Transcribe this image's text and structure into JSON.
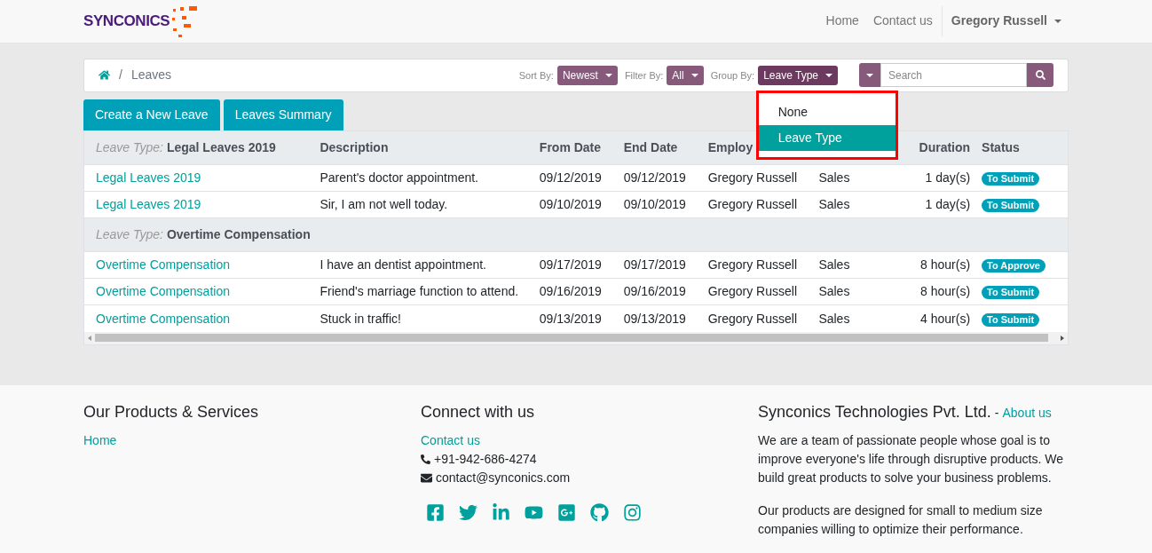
{
  "header": {
    "logo": "SYNCONICS",
    "nav": [
      {
        "label": "Home"
      },
      {
        "label": "Contact us"
      }
    ],
    "user": "Gregory Russell"
  },
  "breadcrumb": {
    "separator": "/",
    "current": "Leaves"
  },
  "toolbar": {
    "filters": [
      {
        "label": "Sort By:",
        "value": "Newest",
        "expanded": false
      },
      {
        "label": "Filter By:",
        "value": "All",
        "expanded": false
      },
      {
        "label": "Group By:",
        "value": "Leave Type",
        "expanded": true
      }
    ],
    "group_menu": [
      {
        "label": "None",
        "selected": false
      },
      {
        "label": "Leave Type",
        "selected": true
      }
    ],
    "search": {
      "placeholder": "Search"
    }
  },
  "actions": [
    "Create a New Leave",
    "Leaves Summary"
  ],
  "table": {
    "columns": [
      {
        "label": "Description"
      },
      {
        "label": "From Date"
      },
      {
        "label": "End Date"
      },
      {
        "label": "Employ"
      },
      {},
      {
        "label": "Duration"
      },
      {
        "label": "Status"
      }
    ],
    "groups": [
      {
        "prefix": "Leave Type:",
        "name": "Legal Leaves 2019",
        "rows": [
          [
            "Legal Leaves 2019",
            "Parent's doctor appointment.",
            "09/12/2019",
            "09/12/2019",
            "Gregory Russell",
            "Sales",
            "1 day(s)",
            "To Submit"
          ],
          [
            "Legal Leaves 2019",
            "Sir, I am not well today.",
            "09/10/2019",
            "09/10/2019",
            "Gregory Russell",
            "Sales",
            "1 day(s)",
            "To Submit"
          ]
        ]
      },
      {
        "prefix": "Leave Type:",
        "name": "Overtime Compensation",
        "rows": [
          [
            "Overtime Compensation",
            "I have an dentist appointment.",
            "09/17/2019",
            "09/17/2019",
            "Gregory Russell",
            "Sales",
            "8 hour(s)",
            "To Approve"
          ],
          [
            "Overtime Compensation",
            "Friend's marriage function to attend.",
            "09/16/2019",
            "09/16/2019",
            "Gregory Russell",
            "Sales",
            "8 hour(s)",
            "To Submit"
          ],
          [
            "Overtime Compensation",
            "Stuck in traffic!",
            "09/13/2019",
            "09/13/2019",
            "Gregory Russell",
            "Sales",
            "4 hour(s)",
            "To Submit"
          ]
        ]
      }
    ]
  },
  "footer": {
    "products": {
      "title": "Our Products & Services",
      "links": [
        "Home"
      ]
    },
    "connect": {
      "title": "Connect with us",
      "link": "Contact us",
      "phone": "+91-942-686-4274",
      "email": "contact@synconics.com"
    },
    "company": {
      "title": "Synconics Technologies Pvt. Ltd.",
      "separator": "-",
      "link": "About us",
      "paragraphs": [
        "We are a team of passionate people whose goal is to improve everyone's life through disruptive products. We build great products to solve your business problems.",
        "Our products are designed for small to medium size companies willing to optimize their performance."
      ]
    }
  }
}
